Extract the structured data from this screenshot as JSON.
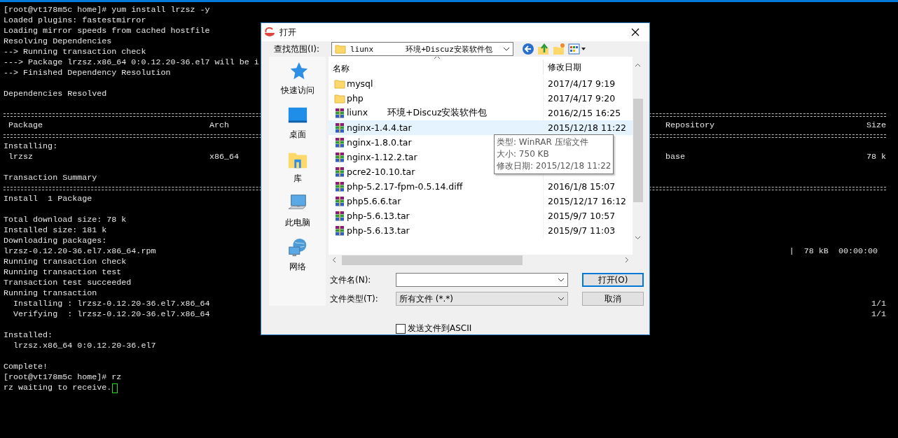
{
  "terminal": {
    "lines": [
      {
        "kind": "text",
        "segments": [
          {
            "kind": "left",
            "text": "[root@vt178m5c home]# yum install lrzsz -y"
          }
        ]
      },
      {
        "kind": "text",
        "segments": [
          {
            "kind": "left",
            "text": "Loaded plugins: fastestmirror"
          }
        ]
      },
      {
        "kind": "text",
        "segments": [
          {
            "kind": "left",
            "text": "Loading mirror speeds from cached hostfile"
          }
        ]
      },
      {
        "kind": "text",
        "segments": [
          {
            "kind": "left",
            "text": "Resolving Dependencies"
          }
        ]
      },
      {
        "kind": "text",
        "segments": [
          {
            "kind": "left",
            "text": "--> Running transaction check"
          }
        ]
      },
      {
        "kind": "text",
        "segments": [
          {
            "kind": "left",
            "text": "---> Package lrzsz.x86_64 0:0.12.20-36.el7 will be i"
          }
        ]
      },
      {
        "kind": "text",
        "segments": [
          {
            "kind": "left",
            "text": "--> Finished Dependency Resolution"
          }
        ]
      },
      {
        "kind": "blank"
      },
      {
        "kind": "text",
        "segments": [
          {
            "kind": "left",
            "text": "Dependencies Resolved"
          }
        ]
      },
      {
        "kind": "blank"
      },
      {
        "kind": "rule"
      },
      {
        "kind": "text",
        "segments": [
          {
            "kind": "left",
            "text": " Package"
          },
          {
            "kind": "arch",
            "text": "Arch"
          },
          {
            "kind": "repo",
            "text": "Repository"
          },
          {
            "kind": "end",
            "text": "Size"
          }
        ]
      },
      {
        "kind": "rule"
      },
      {
        "kind": "text",
        "segments": [
          {
            "kind": "left",
            "text": "Installing:"
          }
        ]
      },
      {
        "kind": "text",
        "segments": [
          {
            "kind": "left",
            "text": " lrzsz"
          },
          {
            "kind": "arch",
            "text": "x86_64"
          },
          {
            "kind": "repo",
            "text": "base"
          },
          {
            "kind": "end",
            "text": "78 k"
          }
        ]
      },
      {
        "kind": "blank"
      },
      {
        "kind": "text",
        "segments": [
          {
            "kind": "left",
            "text": "Transaction Summary"
          }
        ]
      },
      {
        "kind": "rule"
      },
      {
        "kind": "text",
        "segments": [
          {
            "kind": "left",
            "text": "Install  1 Package"
          }
        ]
      },
      {
        "kind": "blank"
      },
      {
        "kind": "text",
        "segments": [
          {
            "kind": "left",
            "text": "Total download size: 78 k"
          }
        ]
      },
      {
        "kind": "text",
        "segments": [
          {
            "kind": "left",
            "text": "Installed size: 181 k"
          }
        ]
      },
      {
        "kind": "text",
        "segments": [
          {
            "kind": "left",
            "text": "Downloading packages:"
          }
        ]
      },
      {
        "kind": "text",
        "segments": [
          {
            "kind": "left",
            "text": "lrzsz-0.12.20-36.el7.x86_64.rpm"
          },
          {
            "kind": "progress",
            "text": "|  78 kB  00:00:00"
          }
        ]
      },
      {
        "kind": "text",
        "segments": [
          {
            "kind": "left",
            "text": "Running transaction check"
          }
        ]
      },
      {
        "kind": "text",
        "segments": [
          {
            "kind": "left",
            "text": "Running transaction test"
          }
        ]
      },
      {
        "kind": "text",
        "segments": [
          {
            "kind": "left",
            "text": "Transaction test succeeded"
          }
        ]
      },
      {
        "kind": "text",
        "segments": [
          {
            "kind": "left",
            "text": "Running transaction"
          }
        ]
      },
      {
        "kind": "text",
        "segments": [
          {
            "kind": "left",
            "text": "  Installing : lrzsz-0.12.20-36.el7.x86_64"
          },
          {
            "kind": "end",
            "text": "1/1"
          }
        ]
      },
      {
        "kind": "text",
        "segments": [
          {
            "kind": "left",
            "text": "  Verifying  : lrzsz-0.12.20-36.el7.x86_64"
          },
          {
            "kind": "end",
            "text": "1/1"
          }
        ]
      },
      {
        "kind": "blank"
      },
      {
        "kind": "text",
        "segments": [
          {
            "kind": "left",
            "text": "Installed:"
          }
        ]
      },
      {
        "kind": "text",
        "segments": [
          {
            "kind": "left",
            "text": "  lrzsz.x86_64 0:0.12.20-36.el7"
          }
        ]
      },
      {
        "kind": "blank"
      },
      {
        "kind": "text",
        "segments": [
          {
            "kind": "left",
            "text": "Complete!"
          }
        ]
      },
      {
        "kind": "text",
        "segments": [
          {
            "kind": "left",
            "text": "[root@vt178m5c home]# rz"
          }
        ]
      },
      {
        "kind": "text",
        "cursor": true,
        "segments": [
          {
            "kind": "left",
            "text": "rz waiting to receive."
          }
        ]
      }
    ]
  },
  "dialog": {
    "title": "打开",
    "look_in": {
      "label": "查找范围(I):",
      "value": "liunx       环境+Discuz安装软件包"
    },
    "places": [
      {
        "kind": "star",
        "label": "快速访问"
      },
      {
        "kind": "desktop",
        "label": "桌面"
      },
      {
        "kind": "library",
        "label": "库"
      },
      {
        "kind": "computer",
        "label": "此电脑"
      },
      {
        "kind": "network",
        "label": "网络"
      }
    ],
    "columns": [
      "名称",
      "修改日期"
    ],
    "files": [
      {
        "kind": "folder",
        "name": "mysql",
        "date": "2017/4/17 9:19",
        "hovered": false
      },
      {
        "kind": "folder",
        "name": "php",
        "date": "2017/4/17 9:20",
        "hovered": false
      },
      {
        "kind": "archive",
        "name": "liunx       环境+Discuz安装软件包",
        "date": "2016/2/15 16:25",
        "hovered": false
      },
      {
        "kind": "archive",
        "name": "nginx-1.4.4.tar",
        "date": "2015/12/18 11:22",
        "hovered": true
      },
      {
        "kind": "archive",
        "name": "nginx-1.8.0.tar",
        "hovered": false
      },
      {
        "kind": "archive",
        "name": "nginx-1.12.2.tar",
        "hovered": false
      },
      {
        "kind": "archive",
        "name": "pcre2-10.10.tar",
        "hovered": false
      },
      {
        "kind": "archive",
        "name": "php-5.2.17-fpm-0.5.14.diff",
        "date": "2016/1/8 15:07",
        "hovered": false
      },
      {
        "kind": "archive",
        "name": "php5.6.6.tar",
        "date": "2015/12/17 16:12",
        "hovered": false
      },
      {
        "kind": "archive",
        "name": "php-5.6.13.tar",
        "date": "2015/9/7 10:57",
        "hovered": false
      },
      {
        "kind": "archive",
        "name": "php-5.6.13.tar",
        "date": "2015/9/7 11:03",
        "hovered": false
      }
    ],
    "tooltip": [
      "类型: WinRAR 压缩文件",
      "大小: 750 KB",
      "修改日期: 2015/12/18 11:22"
    ],
    "file_name": {
      "label": "文件名(N):"
    },
    "file_type": {
      "label": "文件类型(T):",
      "value": "所有文件 (*.*)"
    },
    "buttons": [
      "打开(O)",
      "取消"
    ],
    "ascii": {
      "label": "发送文件到ASCII",
      "checked": false
    }
  }
}
